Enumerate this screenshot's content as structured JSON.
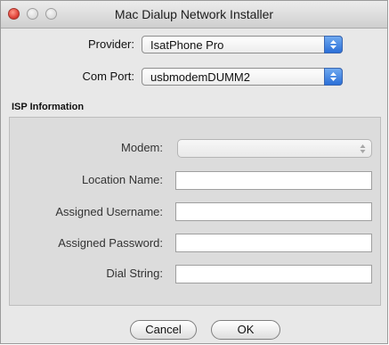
{
  "window": {
    "title": "Mac Dialup Network Installer"
  },
  "provider": {
    "label": "Provider:",
    "value": "IsatPhone Pro"
  },
  "com_port": {
    "label": "Com Port:",
    "value": "usbmodemDUMM2"
  },
  "isp": {
    "title": "ISP Information",
    "modem": {
      "label": "Modem:",
      "value": ""
    },
    "location_name": {
      "label": "Location Name:",
      "value": ""
    },
    "assigned_username": {
      "label": "Assigned Username:",
      "value": ""
    },
    "assigned_password": {
      "label": "Assigned Password:",
      "value": ""
    },
    "dial_string": {
      "label": "Dial String:",
      "value": ""
    }
  },
  "buttons": {
    "cancel": "Cancel",
    "ok": "OK"
  }
}
